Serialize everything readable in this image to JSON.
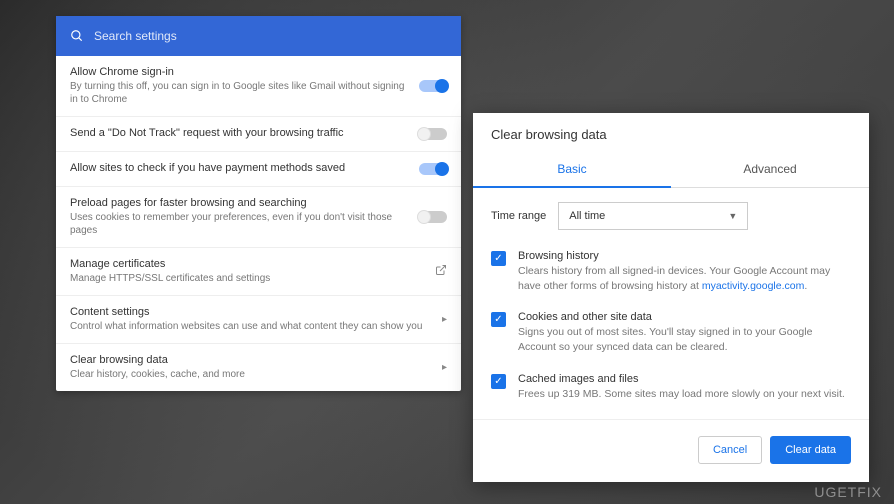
{
  "search": {
    "placeholder": "Search settings"
  },
  "settings": {
    "allow_signin": {
      "title": "Allow Chrome sign-in",
      "desc": "By turning this off, you can sign in to Google sites like Gmail without signing in to Chrome"
    },
    "dnt": {
      "title": "Send a \"Do Not Track\" request with your browsing traffic"
    },
    "payment": {
      "title": "Allow sites to check if you have payment methods saved"
    },
    "preload": {
      "title": "Preload pages for faster browsing and searching",
      "desc": "Uses cookies to remember your preferences, even if you don't visit those pages"
    },
    "certs": {
      "title": "Manage certificates",
      "desc": "Manage HTTPS/SSL certificates and settings"
    },
    "content": {
      "title": "Content settings",
      "desc": "Control what information websites can use and what content they can show you"
    },
    "clear": {
      "title": "Clear browsing data",
      "desc": "Clear history, cookies, cache, and more"
    }
  },
  "dialog": {
    "title": "Clear browsing data",
    "tabs": {
      "basic": "Basic",
      "advanced": "Advanced"
    },
    "time_label": "Time range",
    "time_value": "All time",
    "history": {
      "title": "Browsing history",
      "desc_a": "Clears history from all signed-in devices. Your Google Account may have other forms of browsing history at ",
      "link": "myactivity.google.com",
      "desc_b": "."
    },
    "cookies": {
      "title": "Cookies and other site data",
      "desc": "Signs you out of most sites. You'll stay signed in to your Google Account so your synced data can be cleared."
    },
    "cache": {
      "title": "Cached images and files",
      "desc": "Frees up 319 MB. Some sites may load more slowly on your next visit."
    },
    "cancel": "Cancel",
    "confirm": "Clear data"
  },
  "watermark": "UGETFIX"
}
